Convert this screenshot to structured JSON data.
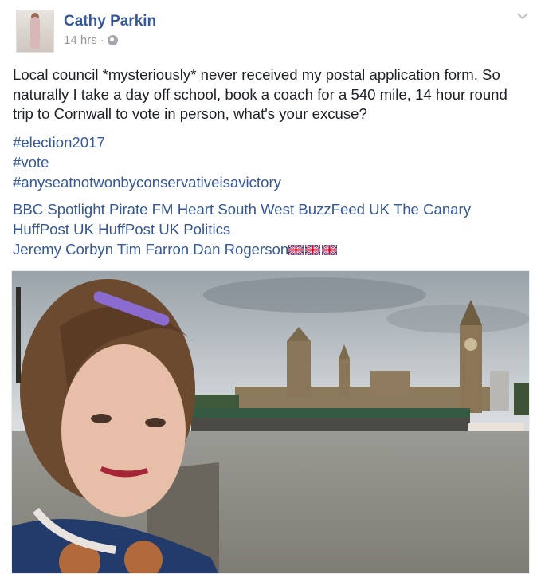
{
  "post": {
    "author": "Cathy Parkin",
    "time": "14 hrs",
    "separator": "·",
    "text": "Local council *mysteriously* never received my postal application form. So naturally I take a day off school, book a coach for a 540 mile, 14 hour round trip to Cornwall to vote in person, what's your excuse?",
    "hashtags": [
      "#election2017",
      "#vote",
      "#anyseatnotwonbyconservativeisavictory"
    ],
    "mentions_line1": [
      "BBC Spotlight",
      "Pirate FM",
      "Heart South West",
      "BuzzFeed UK",
      "The Canary"
    ],
    "mentions_line2": [
      "HuffPost UK",
      "HuffPost UK Politics"
    ],
    "mentions_line3": [
      "Jeremy Corbyn",
      "Tim Farron",
      "Dan Rogerson"
    ],
    "flag_count": 3
  },
  "icons": {
    "privacy": "globe-icon",
    "menu": "chevron-down-icon",
    "flag": "union-jack-flag-icon"
  },
  "colors": {
    "link": "#365899",
    "text": "#1d2129",
    "meta": "#90949c"
  }
}
